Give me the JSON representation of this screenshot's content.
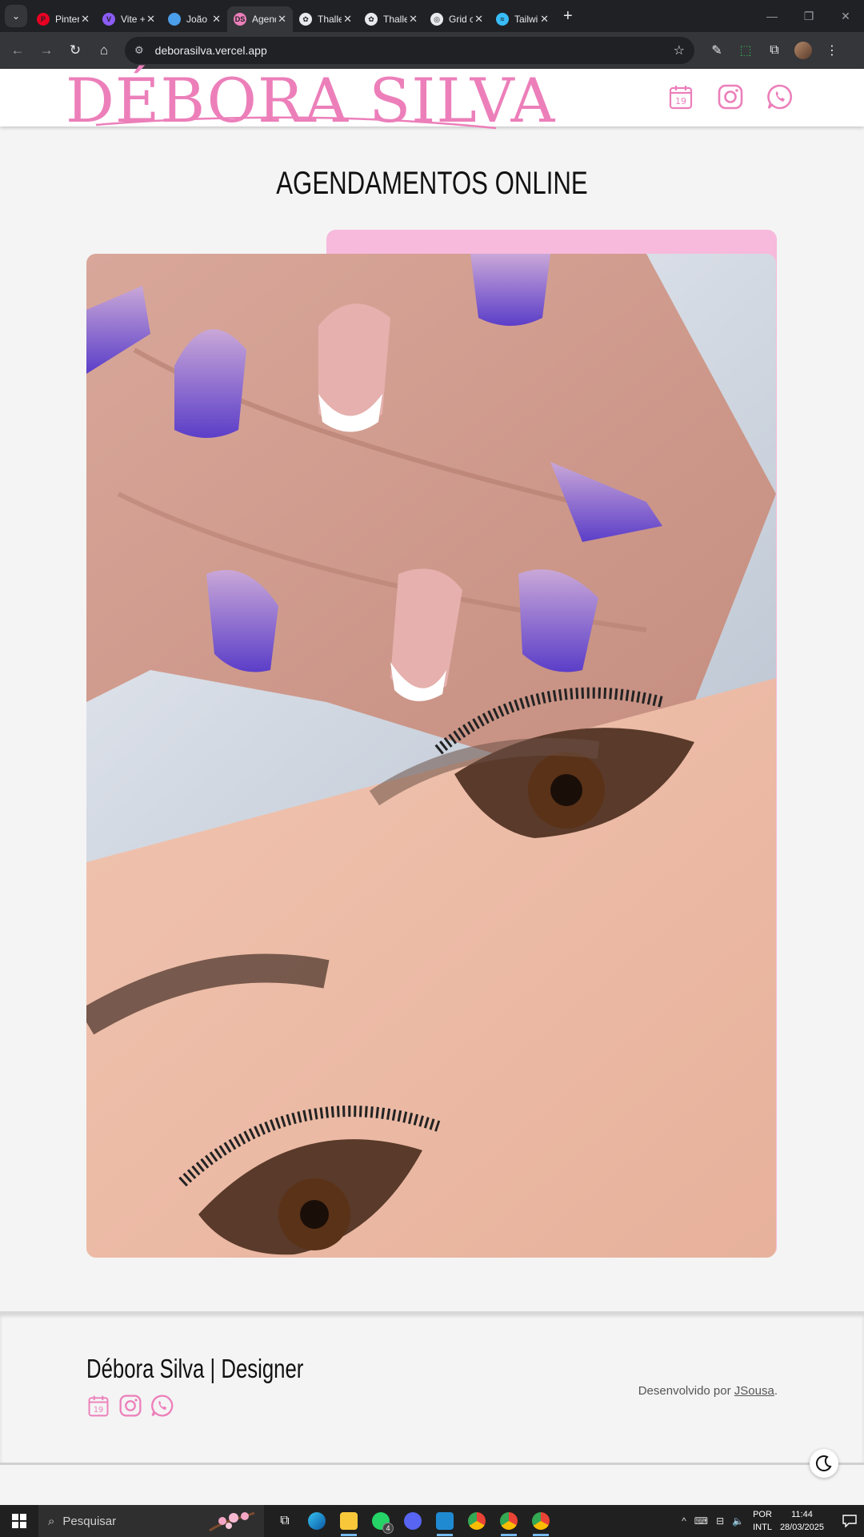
{
  "browser": {
    "tabs": [
      {
        "label": "Pinterest",
        "color": "#e60023",
        "glyph": "P"
      },
      {
        "label": "Vite + React",
        "color": "#8b5cf6",
        "glyph": "V"
      },
      {
        "label": "João Sousa",
        "color": "#4a9eea",
        "glyph": ""
      },
      {
        "label": "Agendamentos",
        "color": "#ec7fba",
        "glyph": "DS"
      },
      {
        "label": "Thalles",
        "color": "#e8eaed",
        "glyph": "✿"
      },
      {
        "label": "Thalles",
        "color": "#e8eaed",
        "glyph": "✿"
      },
      {
        "label": "Grid css",
        "color": "#e8eaed",
        "glyph": "◎"
      },
      {
        "label": "Tailwind",
        "color": "#38bdf8",
        "glyph": "≈"
      }
    ],
    "active_tab": 3,
    "url": "deborasilva.vercel.app"
  },
  "site": {
    "logo": "DÉBORA SILVA",
    "calendar_day": "19",
    "page_title": "AGENDAMENTOS ONLINE",
    "footer_brand": "Débora Silva | Designer",
    "credit_prefix": "Desenvolvido por ",
    "credit_link": "JSousa",
    "credit_suffix": ".",
    "accent": "#ec7fba",
    "accent_light": "#f7b9dc"
  },
  "taskbar": {
    "search_placeholder": "Pesquisar",
    "whatsapp_badge": "4",
    "lang_top": "POR",
    "lang_bottom": "INTL",
    "time": "11:44",
    "date": "28/03/2025"
  }
}
